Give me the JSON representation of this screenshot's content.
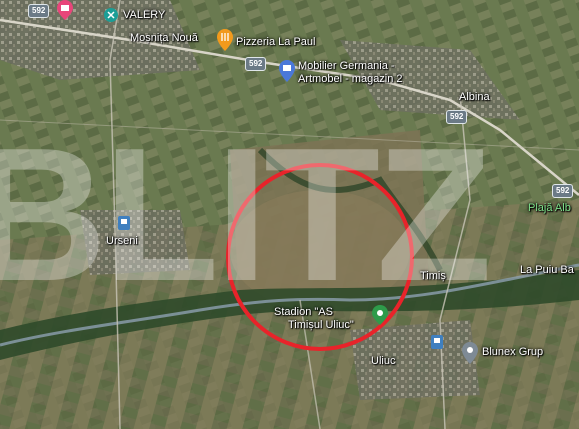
{
  "map": {
    "places": {
      "valery": "VALERY",
      "mosnita_noua": "Moșnița Nouă",
      "pizzeria": "Pizzeria La Paul",
      "mobilier_line1": "Mobilier Germania -",
      "mobilier_line2": "Artmobel - magazin 2",
      "albina": "Albina",
      "urseni": "Urseni",
      "plaja": "Plajă Alb",
      "la_puiu": "La Puiu Ba",
      "timis": "Timiș",
      "stadion_line1": "Stadion \"AS",
      "stadion_line2": "Timișul Uliuc\"",
      "uliuc": "Uliuc",
      "blunex": "Blunex Grup"
    },
    "road_shields": [
      "592",
      "592",
      "592",
      "592"
    ],
    "watermark": "BLITZ",
    "icons": [
      "shopping-icon",
      "pizza-icon",
      "store-icon",
      "place-icon",
      "park-icon",
      "transit-icon"
    ],
    "circle_color": "#e8232a"
  }
}
